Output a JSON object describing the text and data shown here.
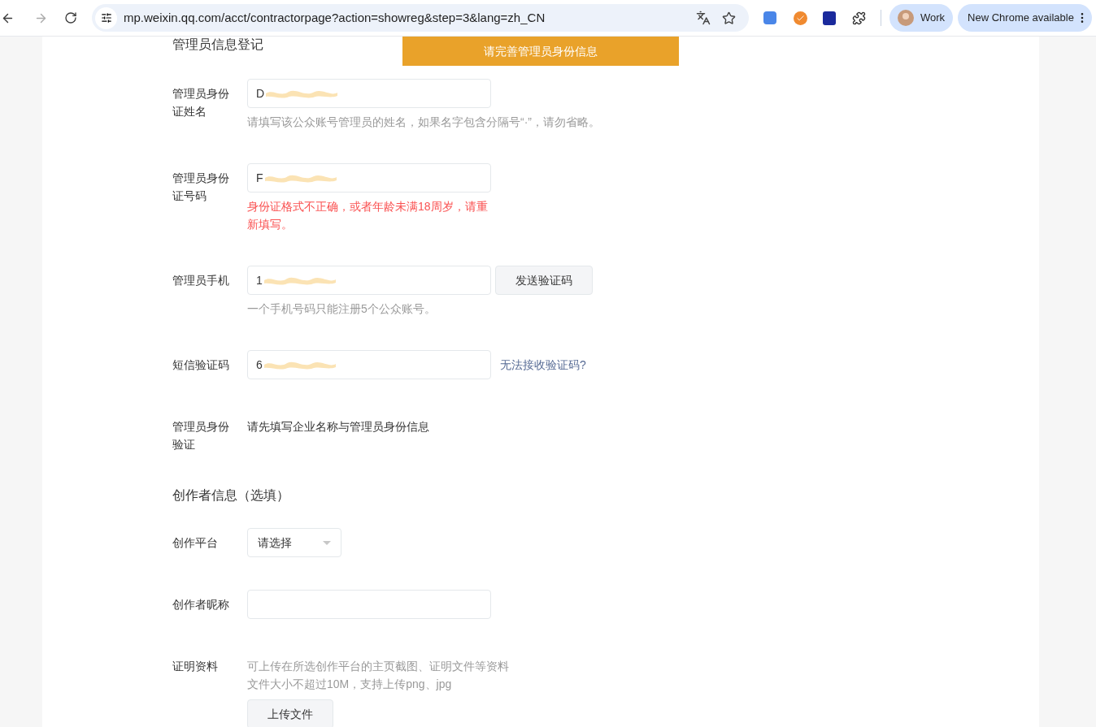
{
  "browser": {
    "url": "mp.weixin.qq.com/acct/contractorpage?action=showreg&step=3&lang=zh_CN",
    "profile": "Work",
    "update_button": "New Chrome available"
  },
  "page": {
    "section_title": "管理员信息登记",
    "alert": "请完善管理员身份信息",
    "admin_fields": [
      {
        "kind": "input",
        "label": "管理员身份证姓名",
        "value": "D",
        "redacted": true,
        "hint": "请填写该公众账号管理员的姓名，如果名字包含分隔号“·”，请勿省略。",
        "hint_error": false
      },
      {
        "kind": "input",
        "label": "管理员身份证号码",
        "value": "F",
        "redacted": true,
        "hint": "身份证格式不正确，或者年龄未满18周岁，请重新填写。",
        "hint_error": true
      },
      {
        "kind": "input_button",
        "label": "管理员手机",
        "value": "1",
        "redacted": true,
        "button": "发送验证码",
        "hint": "一个手机号码只能注册5个公众账号。",
        "hint_error": false
      },
      {
        "kind": "input_link",
        "label": "短信验证码",
        "value": "6",
        "redacted": true,
        "link": "无法接收验证码?"
      },
      {
        "kind": "text",
        "label": "管理员身份验证",
        "text": "请先填写企业名称与管理员身份信息"
      }
    ],
    "creator_title": "创作者信息（选填）",
    "creator_fields": [
      {
        "kind": "select",
        "label": "创作平台",
        "placeholder": "请选择"
      },
      {
        "kind": "input",
        "label": "创作者昵称"
      },
      {
        "kind": "upload",
        "label": "证明资料",
        "lines": [
          "可上传在所选创作平台的主页截图、证明文件等资料",
          "文件大小不超过10M，支持上传png、jpg"
        ],
        "button": "上传文件"
      }
    ]
  }
}
